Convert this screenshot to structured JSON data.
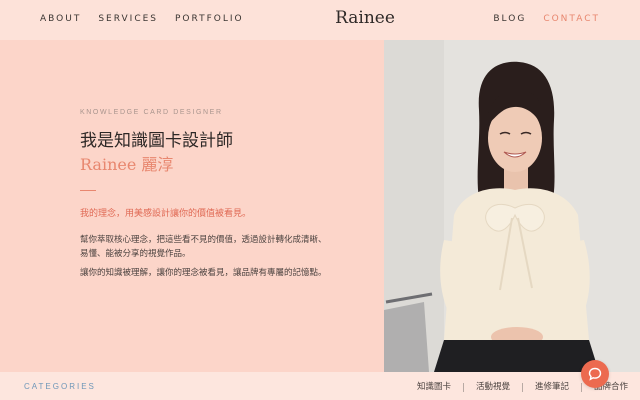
{
  "nav": {
    "left": [
      "ABOUT",
      "SERVICES",
      "PORTFOLIO"
    ],
    "brand": "Rainee",
    "right": [
      "BLOG",
      "CONTACT"
    ]
  },
  "hero": {
    "eyebrow": "KNOWLEDGE CARD DESIGNER",
    "headline": "我是知識圖卡設計師",
    "name": "Rainee 麗淳",
    "tagline": "我的理念，用美感設計讓你的價值被看見。",
    "paragraph1": "幫你萃取核心理念，把這些看不見的價值，透過設計轉化成清晰、易懂、能被分享的視覺作品。",
    "paragraph2": "讓你的知識被理解，讓你的理念被看見，讓品牌有專屬的記憶點。"
  },
  "footer": {
    "categories_label": "CATEGORIES",
    "categories": [
      "知識圖卡",
      "活動視覺",
      "進修筆記",
      "品牌合作"
    ]
  },
  "chat": {
    "icon": "chat-bubble-icon"
  },
  "colors": {
    "accent": "#e8876f",
    "background": "#fcd5c9",
    "chat_button": "#ec6a4f"
  }
}
